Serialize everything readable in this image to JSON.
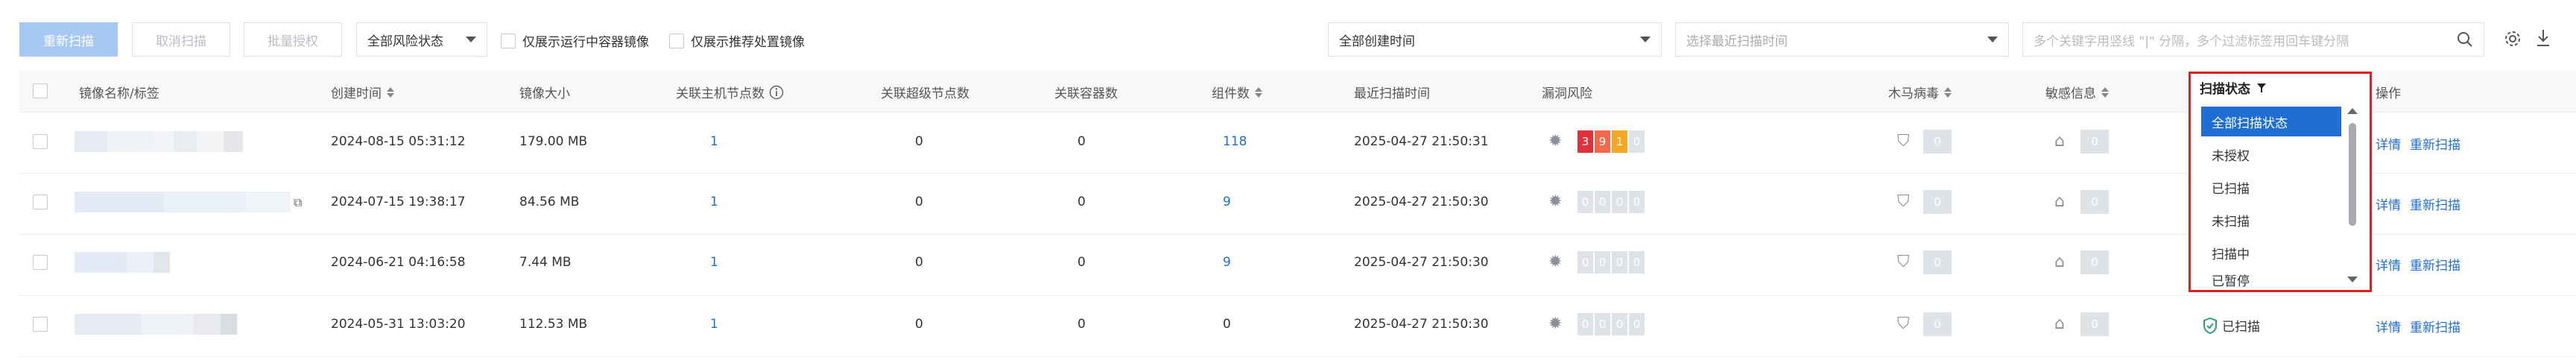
{
  "toolbar": {
    "rescan": "重新扫描",
    "cancel_scan": "取消扫描",
    "batch_authorize": "批量授权",
    "risk_status": "全部风险状态",
    "only_running": "仅展示运行中容器镜像",
    "only_recommended": "仅展示推荐处置镜像",
    "created_time": "全部创建时间",
    "recent_scan_placeholder": "选择最近扫描时间",
    "search_placeholder": "多个关键字用竖线 \"|\" 分隔，多个过滤标签用回车键分隔"
  },
  "table": {
    "headers": {
      "image_name": "镜像名称/标签",
      "created_time": "创建时间",
      "size": "镜像大小",
      "host_nodes": "关联主机节点数",
      "super_nodes": "关联超级节点数",
      "containers": "关联容器数",
      "components": "组件数",
      "last_scan": "最近扫描时间",
      "vuln_risk": "漏洞风险",
      "trojan": "木马病毒",
      "sensitive": "敏感信息",
      "scan_status": "扫描状态",
      "operations": "操作"
    },
    "rows": [
      {
        "created": "2024-08-15 05:31:12",
        "size": "179.00 MB",
        "hosts": "1",
        "super": "0",
        "containers": "0",
        "components": "118",
        "last_scan": "2025-04-27 21:50:31",
        "risk": [
          "3",
          "9",
          "1",
          "0"
        ],
        "trojan": "0",
        "sensitive": "0",
        "op_detail": "详情",
        "op_rescan": "重新扫描"
      },
      {
        "created": "2024-07-15 19:38:17",
        "size": "84.56 MB",
        "hosts": "1",
        "super": "0",
        "containers": "0",
        "components": "9",
        "last_scan": "2025-04-27 21:50:30",
        "risk": [
          "0",
          "0",
          "0",
          "0"
        ],
        "trojan": "0",
        "sensitive": "0",
        "op_detail": "详情",
        "op_rescan": "重新扫描"
      },
      {
        "created": "2024-06-21 04:16:58",
        "size": "7.44 MB",
        "hosts": "1",
        "super": "0",
        "containers": "0",
        "components": "9",
        "last_scan": "2025-04-27 21:50:30",
        "risk": [
          "0",
          "0",
          "0",
          "0"
        ],
        "trojan": "0",
        "sensitive": "0",
        "op_detail": "详情",
        "op_rescan": "重新扫描"
      },
      {
        "created": "2024-05-31 13:03:20",
        "size": "112.53 MB",
        "hosts": "1",
        "super": "0",
        "containers": "0",
        "components": "0",
        "last_scan": "2025-04-27 21:50:30",
        "risk": [
          "0",
          "0",
          "0",
          "0"
        ],
        "trojan": "0",
        "sensitive": "0",
        "status": "已扫描",
        "op_detail": "详情",
        "op_rescan": "重新扫描"
      }
    ]
  },
  "scan_status_filter": {
    "options": [
      "全部扫描状态",
      "未授权",
      "已扫描",
      "未扫描",
      "扫描中",
      "已暂停"
    ],
    "selected": "全部扫描状态"
  },
  "colors": {
    "primary": "#1f6ed4",
    "risk_critical": "#e0313d",
    "risk_high": "#f0694a",
    "risk_medium": "#f5a623",
    "ok_green": "#2ba471",
    "highlight_border": "#e02020"
  }
}
